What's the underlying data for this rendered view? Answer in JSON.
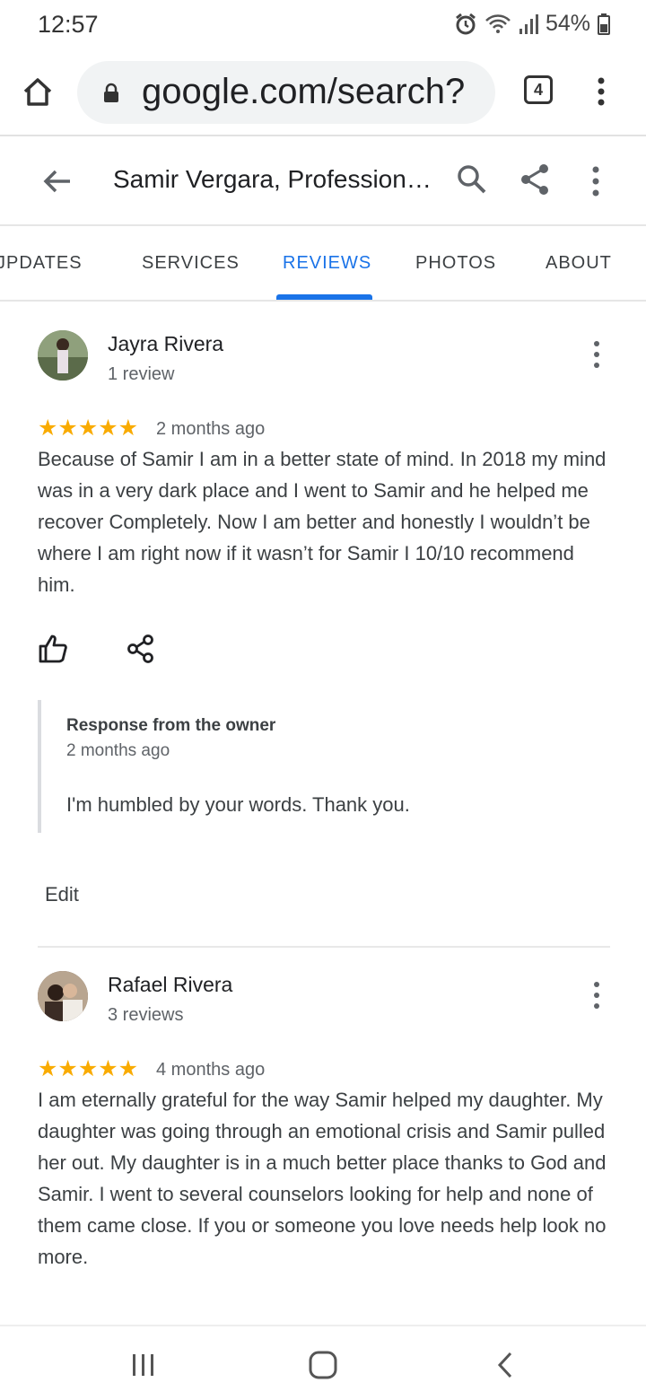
{
  "status_bar": {
    "time": "12:57",
    "battery": "54%"
  },
  "browser": {
    "url": "google.com/search?",
    "tab_count": "4"
  },
  "header": {
    "title": "Samir Vergara, Professional..."
  },
  "tabs": [
    {
      "label": "JPDATES",
      "active": false
    },
    {
      "label": "SERVICES",
      "active": false
    },
    {
      "label": "REVIEWS",
      "active": true
    },
    {
      "label": "PHOTOS",
      "active": false
    },
    {
      "label": "ABOUT",
      "active": false
    }
  ],
  "reviews": [
    {
      "name": "Jayra Rivera",
      "count": "1 review",
      "stars": "★★★★★",
      "rating": 5,
      "date": "2 months ago",
      "text": "Because of Samir I am in a better state of mind. In 2018 my mind was in a very dark place and I went to Samir and he helped me recover Completely. Now I am better and honestly I wouldn’t be where I am right now if it wasn’t for Samir I 10/10 recommend him.",
      "owner_response": {
        "title": "Response from the owner",
        "date": "2 months ago",
        "text": "I'm humbled by your words. Thank you."
      },
      "edit_label": "Edit"
    },
    {
      "name": "Rafael Rivera",
      "count": "3 reviews",
      "stars": "★★★★★",
      "rating": 5,
      "date": "4 months ago",
      "text": "I am eternally grateful for the way Samir helped my daughter. My daughter was going through an emotional crisis and Samir pulled her out. My daughter is in a much better place thanks to God and Samir. I went to several counselors looking for help and none of them came close. If you or someone you love needs help look no more."
    }
  ],
  "colors": {
    "accent": "#1a73e8",
    "star": "#f9ab00"
  },
  "icons": [
    "home-icon",
    "lock-icon",
    "tab-switcher-icon",
    "more-vert-icon",
    "back-arrow-icon",
    "search-icon",
    "share-icon",
    "thumbs-up-icon",
    "recents-icon",
    "nav-home-icon",
    "nav-back-icon"
  ]
}
